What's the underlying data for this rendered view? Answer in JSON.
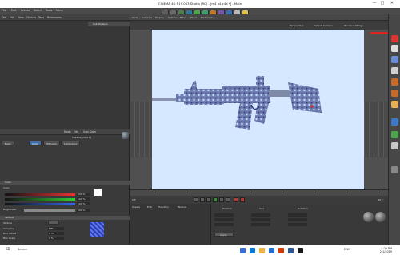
{
  "window": {
    "title": "CINEMA 4D R19.053 Studio (RC) - [m4 a4.c4d *] - Main",
    "minimize": "—",
    "maximize": "□",
    "close": "✕"
  },
  "menubar": {
    "items": [
      "File",
      "Edit",
      "Create",
      "Select",
      "Tools",
      "Mesh",
      "Snap",
      "Animate",
      "Simulate",
      "Render",
      "Sculpt",
      "Motion Tracker",
      "MoGraph",
      "Character",
      "Pipeline",
      "Plugins",
      "Script",
      "Window",
      "Help",
      "Layout:"
    ]
  },
  "object_manager": {
    "tabs": [
      "File",
      "Edit",
      "View",
      "Objects",
      "Tags",
      "Bookmarks"
    ],
    "row_label": "Sub-Division"
  },
  "viewport": {
    "menus": [
      "View",
      "Cameras",
      "Display",
      "Options",
      "Filter",
      "Panel",
      "ProRender"
    ],
    "sub_menus": [
      "Perspective",
      "Default Camera",
      "Render Settings"
    ]
  },
  "attributes": {
    "tabs": [
      "Mode",
      "Edit",
      "User Data"
    ],
    "material_title": "Material [Mat.1]",
    "subtabs": [
      "Basic",
      "Color",
      "Diffusion",
      "Luminance",
      "Reflectance"
    ],
    "section_color": "Color",
    "section_texture": "Texture",
    "fields": {
      "color_label": "Color",
      "r_value": "100 %",
      "g_value": "100 %",
      "b_value": "100 %",
      "brightness_label": "Brightness",
      "brightness_value": "100 %",
      "texture_label": "Texture",
      "sampling_label": "Sampling",
      "sampling_value": "MIP",
      "blur_offset_label": "Blur Offset",
      "blur_offset_value": "0 %",
      "blur_scale_label": "Blur Scale",
      "blur_scale_value": "0 %",
      "mix_mode_label": "Mix Mode",
      "mix_mode_value": "Normal"
    }
  },
  "timeline": {
    "frames": [
      "0",
      "5",
      "10",
      "15",
      "20",
      "25",
      "30",
      "35",
      "40",
      "45",
      "50",
      "55",
      "60",
      "65",
      "70",
      "75",
      "80",
      "85",
      "90"
    ],
    "current_frame": "0 F",
    "end_frame": "90 F"
  },
  "materials": {
    "menus": [
      "Create",
      "Edit",
      "Function",
      "Texture"
    ]
  },
  "coordinates": {
    "headers": [
      "Position",
      "Size",
      "Rotation"
    ],
    "apply_label": "Apply"
  },
  "taskbar": {
    "search_placeholder": "Search",
    "language": "ENG",
    "time": "4:22 PM",
    "date": "2/1/2019"
  },
  "colors": {
    "viewport_bg": "#d6e8ff",
    "ui_dark": "#3d3d3d",
    "accent_tab": "#3f6fa8",
    "weapon": "#6b7fb4"
  }
}
